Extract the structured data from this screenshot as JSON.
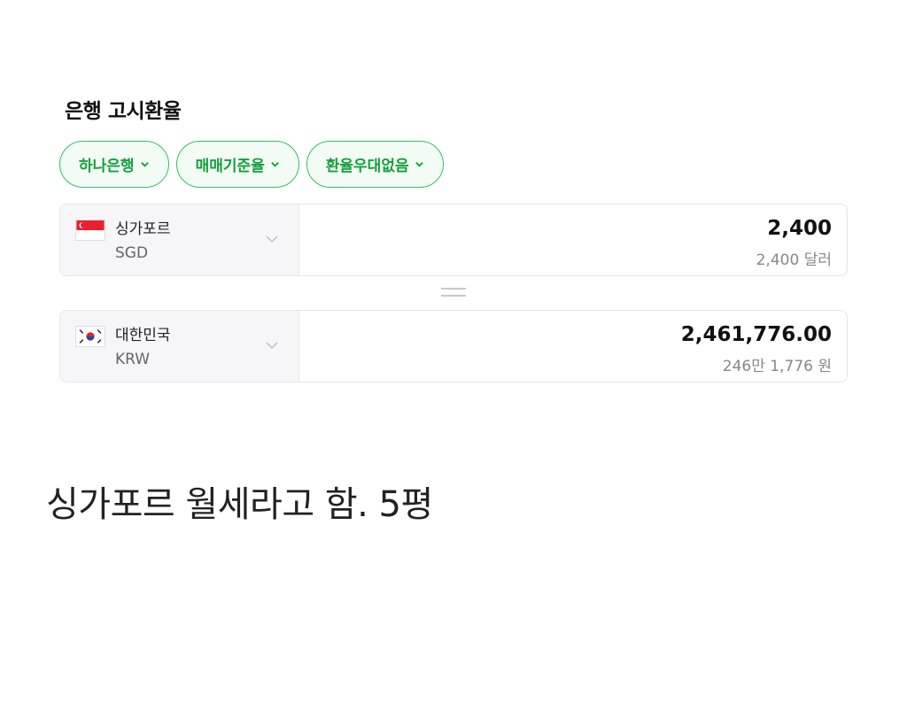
{
  "widget": {
    "title": "은행 고시환율",
    "filters": [
      {
        "label": "하나은행"
      },
      {
        "label": "매매기준율"
      },
      {
        "label": "환율우대없음"
      }
    ],
    "from": {
      "country": "싱가포르",
      "code": "SGD",
      "amount": "2,400",
      "amount_reading": "2,400 달러"
    },
    "to": {
      "country": "대한민국",
      "code": "KRW",
      "amount": "2,461,776.00",
      "amount_reading": "246만 1,776 원"
    },
    "accent_color": "#31c061"
  },
  "caption": "싱가포르 월세라고 함. 5평"
}
